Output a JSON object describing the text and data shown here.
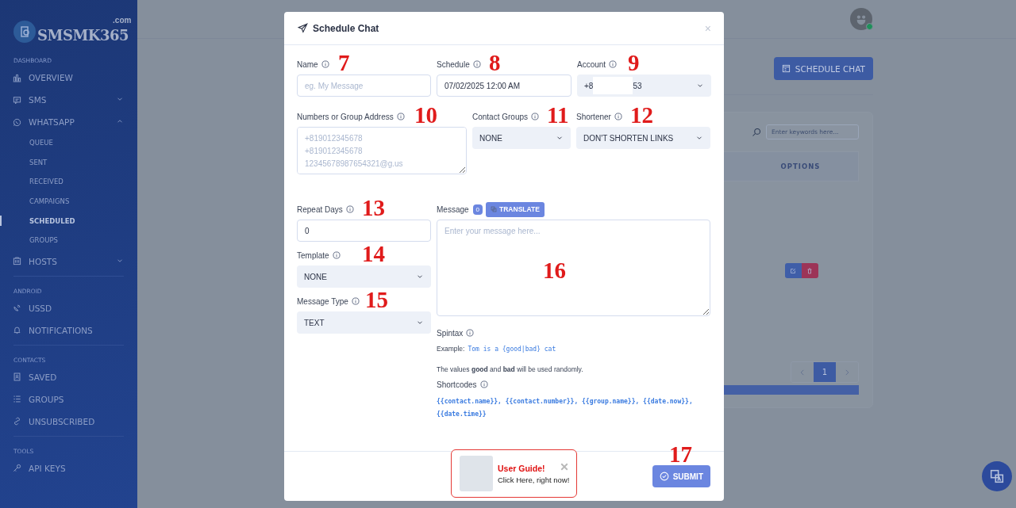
{
  "sidebar": {
    "logo": {
      "name": "SMSMK365",
      "suffix": ".com"
    },
    "sections": [
      {
        "heading": "DASHBOARD",
        "items": [
          {
            "label": "OVERVIEW"
          },
          {
            "label": "SMS",
            "expanded": false
          },
          {
            "label": "WHATSAPP",
            "expanded": true,
            "children": [
              {
                "label": "QUEUE",
                "selected": false
              },
              {
                "label": "SENT",
                "selected": false
              },
              {
                "label": "RECEIVED",
                "selected": false
              },
              {
                "label": "CAMPAIGNS",
                "selected": false
              },
              {
                "label": "SCHEDULED",
                "selected": true
              },
              {
                "label": "GROUPS",
                "selected": false
              }
            ]
          },
          {
            "label": "HOSTS",
            "expanded": false
          }
        ]
      },
      {
        "heading": "ANDROID",
        "items": [
          {
            "label": "USSD"
          },
          {
            "label": "NOTIFICATIONS"
          }
        ]
      },
      {
        "heading": "CONTACTS",
        "items": [
          {
            "label": "SAVED"
          },
          {
            "label": "GROUPS"
          },
          {
            "label": "UNSUBSCRIBED"
          }
        ]
      },
      {
        "heading": "TOOLS",
        "items": [
          {
            "label": "API KEYS"
          }
        ]
      }
    ]
  },
  "page": {
    "action_button": "SCHEDULE CHAT",
    "search": {
      "placeholder": "Enter keywords here..."
    },
    "table": {
      "columns": [
        "OPTIONS"
      ]
    },
    "pagination": [
      {
        "label": "1",
        "selected": true
      }
    ]
  },
  "modal": {
    "title": "Schedule Chat",
    "close": "×",
    "fields": [
      {
        "label": "Name",
        "kind": "input",
        "placeholder": "eg. My Message",
        "callout": "7"
      },
      {
        "label": "Schedule",
        "kind": "input",
        "value": "07/02/2025 12:00 AM",
        "callout": "8"
      },
      {
        "label": "Account",
        "kind": "select",
        "value": "+8",
        "value_after_redaction": "53",
        "callout": "9"
      },
      {
        "label": "Numbers or Group Address",
        "kind": "textarea",
        "placeholder": "+819012345678\n+819012345678\n12345678987654321@g.us",
        "callout": "10"
      },
      {
        "label": "Contact Groups",
        "kind": "select",
        "value": "NONE",
        "callout": "11"
      },
      {
        "label": "Shortener",
        "kind": "select",
        "value": "DON'T SHORTEN LINKS",
        "callout": "12"
      },
      {
        "label": "Repeat Days",
        "kind": "input",
        "value": "0",
        "callout": "13"
      },
      {
        "label": "Template",
        "kind": "select",
        "value": "NONE",
        "callout": "14"
      },
      {
        "label": "Message Type",
        "kind": "select",
        "value": "TEXT",
        "callout": "15"
      }
    ],
    "message": {
      "label": "Message",
      "count": "0",
      "translate_button": "TRANSLATE",
      "placeholder": "Enter your message here...",
      "callout": "16"
    },
    "spintax": {
      "label": "Spintax",
      "example_label": "Example:",
      "example_code": "Tom is a {good|bad} cat",
      "note": "The values **good** and **bad** will be used randomly."
    },
    "shortcodes": {
      "label": "Shortcodes",
      "codes": "{{contact.name}}, {{contact.number}}, {{group.name}}, {{date.now}}, {{date.time}}"
    },
    "submit_button": "SUBMIT",
    "submit_callout": "17",
    "guide": {
      "title": "User Guide!",
      "text": "Click Here, right now!"
    }
  }
}
